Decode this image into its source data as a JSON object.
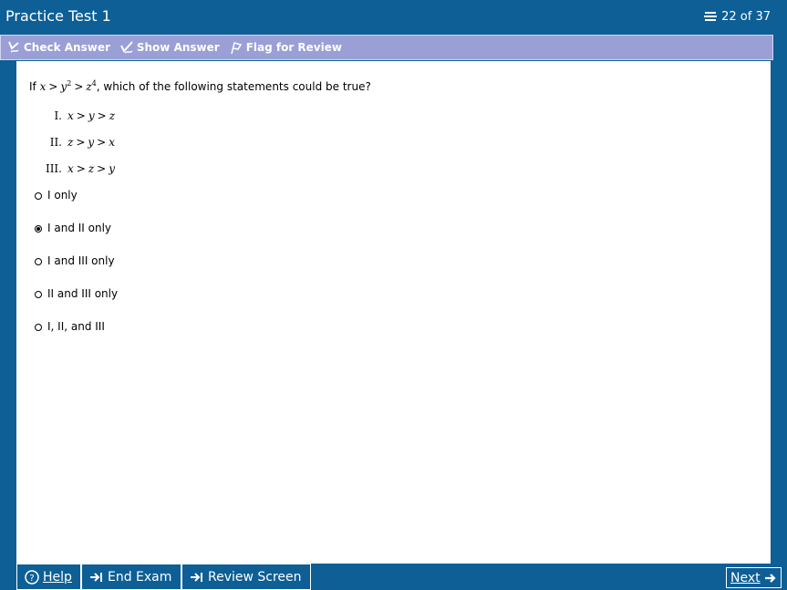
{
  "titlebar": {
    "title": "Practice Test 1",
    "counter": "22 of 37"
  },
  "toolbar": {
    "check_answer": "Check Answer",
    "show_answer": "Show Answer",
    "flag_for_review": "Flag for Review"
  },
  "question": {
    "prefix": "If",
    "var_x": "x",
    "var_y": "y",
    "var_z": "z",
    "exp_y": "2",
    "exp_z": "4",
    "gt": ">",
    "suffix": ", which of the following statements could be true?",
    "statements": [
      {
        "numeral": "I.",
        "expr": [
          "x",
          "y",
          "z"
        ]
      },
      {
        "numeral": "II.",
        "expr": [
          "z",
          "y",
          "x"
        ]
      },
      {
        "numeral": "III.",
        "expr": [
          "x",
          "z",
          "y"
        ]
      }
    ]
  },
  "choices": [
    {
      "label": "I only",
      "selected": false
    },
    {
      "label": "I and II only",
      "selected": true
    },
    {
      "label": "I and III only",
      "selected": false
    },
    {
      "label": "II and III only",
      "selected": false
    },
    {
      "label": "I, II, and III",
      "selected": false
    }
  ],
  "bottombar": {
    "help": "Help",
    "end_exam": "End Exam",
    "review_screen": "Review Screen",
    "next": "Next"
  },
  "colors": {
    "chrome": "#0d5f96",
    "toolbar": "#9a9fd6",
    "content": "#ffffff"
  }
}
